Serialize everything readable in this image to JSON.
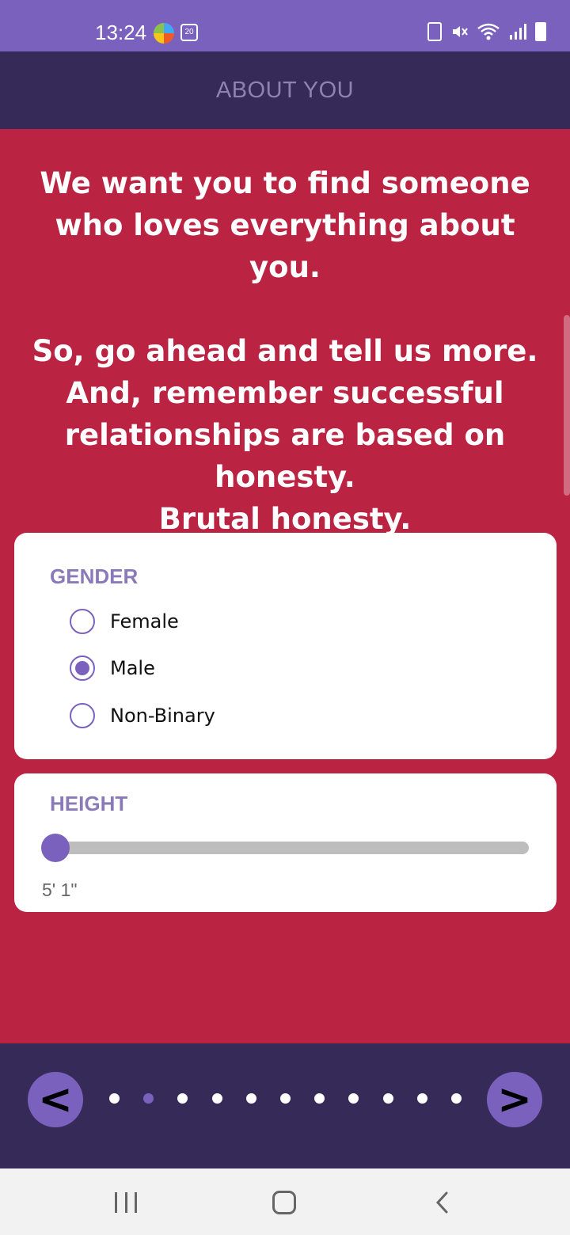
{
  "status_bar": {
    "time": "13:24",
    "calendar_date": "20",
    "icons": [
      "browser-app-icon",
      "calendar-icon",
      "battery-saver-icon",
      "mute-icon",
      "wifi-icon",
      "signal-icon",
      "battery-icon"
    ]
  },
  "header": {
    "title": "ABOUT YOU"
  },
  "intro": {
    "line1": "We want you to find someone",
    "line2": "who loves everything about you.",
    "line3": "So, go ahead and tell us more.",
    "line4": "And, remember successful",
    "line5": "relationships are based on honesty.",
    "line6": "Brutal honesty."
  },
  "gender": {
    "label": "GENDER",
    "options": [
      {
        "label": "Female",
        "checked": false
      },
      {
        "label": "Male",
        "checked": true
      },
      {
        "label": "Non-Binary",
        "checked": false
      }
    ]
  },
  "height": {
    "label": "HEIGHT",
    "value_text": "5' 1\"",
    "slider_fraction": 0
  },
  "pagination": {
    "prev_label": "<",
    "next_label": ">",
    "total_pages": 11,
    "current_page_index": 1
  },
  "colors": {
    "background": "#bb2343",
    "header": "#352a58",
    "accent": "#7b61be",
    "status_bar": "#7b61be"
  }
}
